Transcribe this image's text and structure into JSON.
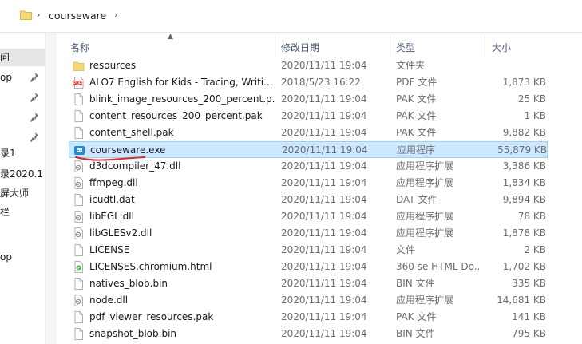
{
  "address": {
    "crumb": "courseware",
    "chevron": "›"
  },
  "nav": {
    "items": [
      {
        "label": "问",
        "selected": true,
        "pinned": false
      },
      {
        "label": "op",
        "selected": false,
        "pinned": true
      },
      {
        "label": "",
        "selected": false,
        "pinned": true
      },
      {
        "label": "",
        "selected": false,
        "pinned": true
      },
      {
        "label": "",
        "selected": false,
        "pinned": true
      },
      {
        "label": "录1",
        "selected": false,
        "pinned": false
      },
      {
        "label": "录2020.1",
        "selected": false,
        "pinned": false
      },
      {
        "label": "屏大师",
        "selected": false,
        "pinned": false
      },
      {
        "label": "栏",
        "selected": false,
        "pinned": false
      },
      {
        "label": "op",
        "selected": false,
        "pinned": false
      }
    ]
  },
  "columns": {
    "name": "名称",
    "date": "修改日期",
    "type": "类型",
    "size": "大小"
  },
  "files": [
    {
      "icon": "folder-icon",
      "name": "resources",
      "date": "2020/11/11 19:04",
      "type": "文件夹",
      "size": ""
    },
    {
      "icon": "pdf-icon",
      "name": "ALO7 English for Kids - Tracing, Writi...",
      "date": "2018/5/23 16:22",
      "type": "PDF 文件",
      "size": "1,873 KB"
    },
    {
      "icon": "file-icon",
      "name": "blink_image_resources_200_percent.p...",
      "date": "2020/11/11 19:04",
      "type": "PAK 文件",
      "size": "25 KB"
    },
    {
      "icon": "file-icon",
      "name": "content_resources_200_percent.pak",
      "date": "2020/11/11 19:04",
      "type": "PAK 文件",
      "size": "1 KB"
    },
    {
      "icon": "file-icon",
      "name": "content_shell.pak",
      "date": "2020/11/11 19:04",
      "type": "PAK 文件",
      "size": "9,882 KB"
    },
    {
      "icon": "app-icon",
      "name": "courseware.exe",
      "date": "2020/11/11 19:04",
      "type": "应用程序",
      "size": "55,879 KB",
      "selected": true
    },
    {
      "icon": "dll-icon",
      "name": "d3dcompiler_47.dll",
      "date": "2020/11/11 19:04",
      "type": "应用程序扩展",
      "size": "3,386 KB"
    },
    {
      "icon": "dll-icon",
      "name": "ffmpeg.dll",
      "date": "2020/11/11 19:04",
      "type": "应用程序扩展",
      "size": "1,834 KB"
    },
    {
      "icon": "file-icon",
      "name": "icudtl.dat",
      "date": "2020/11/11 19:04",
      "type": "DAT 文件",
      "size": "9,894 KB"
    },
    {
      "icon": "dll-icon",
      "name": "libEGL.dll",
      "date": "2020/11/11 19:04",
      "type": "应用程序扩展",
      "size": "78 KB"
    },
    {
      "icon": "dll-icon",
      "name": "libGLESv2.dll",
      "date": "2020/11/11 19:04",
      "type": "应用程序扩展",
      "size": "1,878 KB"
    },
    {
      "icon": "file-icon",
      "name": "LICENSE",
      "date": "2020/11/11 19:04",
      "type": "文件",
      "size": "2 KB"
    },
    {
      "icon": "html-icon",
      "name": "LICENSES.chromium.html",
      "date": "2020/11/11 19:04",
      "type": "360 se HTML Do...",
      "size": "1,702 KB"
    },
    {
      "icon": "file-icon",
      "name": "natives_blob.bin",
      "date": "2020/11/11 19:04",
      "type": "BIN 文件",
      "size": "335 KB"
    },
    {
      "icon": "dll-icon",
      "name": "node.dll",
      "date": "2020/11/11 19:04",
      "type": "应用程序扩展",
      "size": "14,681 KB"
    },
    {
      "icon": "file-icon",
      "name": "pdf_viewer_resources.pak",
      "date": "2020/11/11 19:04",
      "type": "PAK 文件",
      "size": "141 KB"
    },
    {
      "icon": "file-icon",
      "name": "snapshot_blob.bin",
      "date": "2020/11/11 19:04",
      "type": "BIN 文件",
      "size": "795 KB"
    }
  ],
  "colors": {
    "selection": "#cce8ff",
    "selection_border": "#99d1ff",
    "folder": "#f8d775",
    "annotation": "#e0242b"
  }
}
